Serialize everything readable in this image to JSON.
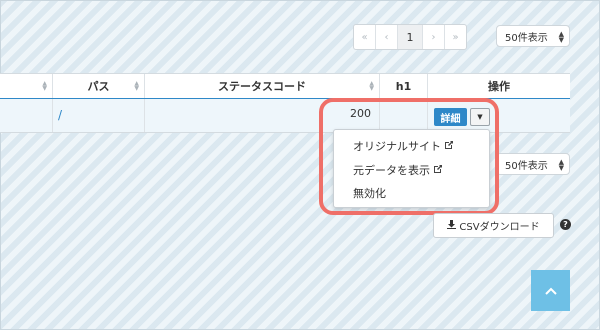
{
  "pagination": {
    "first": "«",
    "prev": "‹",
    "current": "1",
    "next": "›",
    "last": "»"
  },
  "per_page": {
    "selected": "50件表示",
    "arrow": "▲▼"
  },
  "table": {
    "headers": [
      "",
      "パス",
      "ステータスコード",
      "h1",
      "操作"
    ],
    "row": {
      "path": "/",
      "status": "200"
    }
  },
  "actions": {
    "detail": "詳細",
    "caret": "▼"
  },
  "dropdown": {
    "items": [
      "オリジナルサイト",
      "元データを表示",
      "無効化"
    ]
  },
  "csv": {
    "label": "CSVダウンロード"
  },
  "help": "?",
  "to_top": "^",
  "colors": {
    "accent": "#2e88c8",
    "highlight": "#ef6f68",
    "to_top": "#6ec0e6"
  }
}
